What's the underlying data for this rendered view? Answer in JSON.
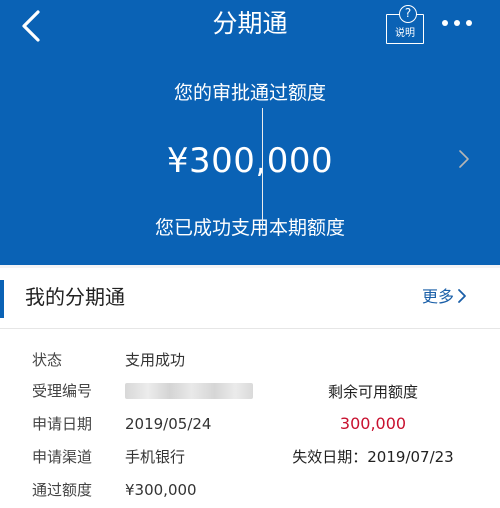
{
  "nav": {
    "title": "分期通",
    "help_question": "?",
    "help_label": "说明"
  },
  "hero": {
    "label": "您的审批通过额度",
    "amount": "¥300,000",
    "status": "您已成功支用本期额度"
  },
  "card": {
    "title": "我的分期通",
    "more_label": "更多",
    "rows": [
      {
        "key": "状态",
        "value": "支用成功"
      },
      {
        "key": "受理编号",
        "value": ""
      },
      {
        "key": "申请日期",
        "value": "2019/05/24"
      },
      {
        "key": "申请渠道",
        "value": "手机银行"
      },
      {
        "key": "通过额度",
        "value": "¥300,000"
      }
    ],
    "remaining_label": "剩余可用额度",
    "remaining_amount": "300,000",
    "expiry": "失效日期：2019/07/23"
  },
  "colors": {
    "brand_blue": "#0a62b5",
    "amount_red": "#c8102e",
    "link_blue": "#1a5fa8"
  },
  "icons": {
    "back": "chevron-left-icon",
    "help": "help-doc-icon",
    "more": "more-dots-icon",
    "more_link": "chevron-right-icon",
    "detail": "chevron-right-icon"
  }
}
